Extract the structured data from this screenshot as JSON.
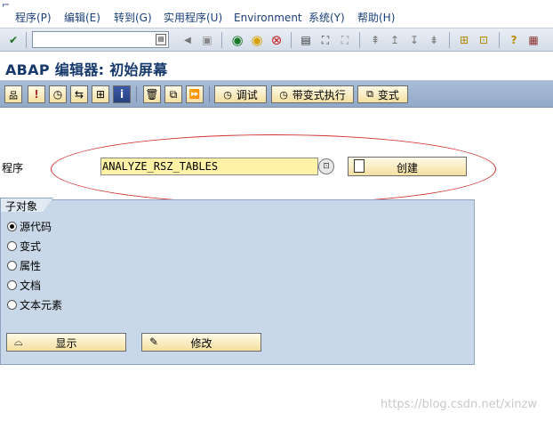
{
  "menu": [
    {
      "label": "程序(P)"
    },
    {
      "label": "编辑(E)"
    },
    {
      "label": "转到(G)"
    },
    {
      "label": "实用程序(U)"
    },
    {
      "label": "Environment"
    },
    {
      "label": "系统(Y)"
    },
    {
      "label": "帮助(H)"
    }
  ],
  "toolbar": {
    "command_value": "",
    "icons": [
      "enter-icon",
      "back-icon",
      "exit-icon",
      "cancel-icon",
      "print-icon",
      "find-icon",
      "find-next-icon",
      "first-page-icon",
      "prev-page-icon",
      "next-page-icon",
      "last-page-icon",
      "new-session-icon",
      "shortcut-icon",
      "help-icon",
      "layout-icon"
    ]
  },
  "title": "ABAP 编辑器: 初始屏幕",
  "app_toolbar": {
    "debug_label": "调试",
    "run_variant_label": "带变式执行",
    "variant_label": "变式"
  },
  "program": {
    "label": "程序",
    "value": "ANALYZE_RSZ_TABLES",
    "create_label": "创建"
  },
  "subobjects": {
    "title": "子对象",
    "options": [
      {
        "label": "源代码",
        "checked": true
      },
      {
        "label": "变式",
        "checked": false
      },
      {
        "label": "属性",
        "checked": false
      },
      {
        "label": "文档",
        "checked": false
      },
      {
        "label": "文本元素",
        "checked": false
      }
    ],
    "display_label": "显示",
    "change_label": "修改"
  },
  "watermark": "https://blog.csdn.net/xinzw"
}
